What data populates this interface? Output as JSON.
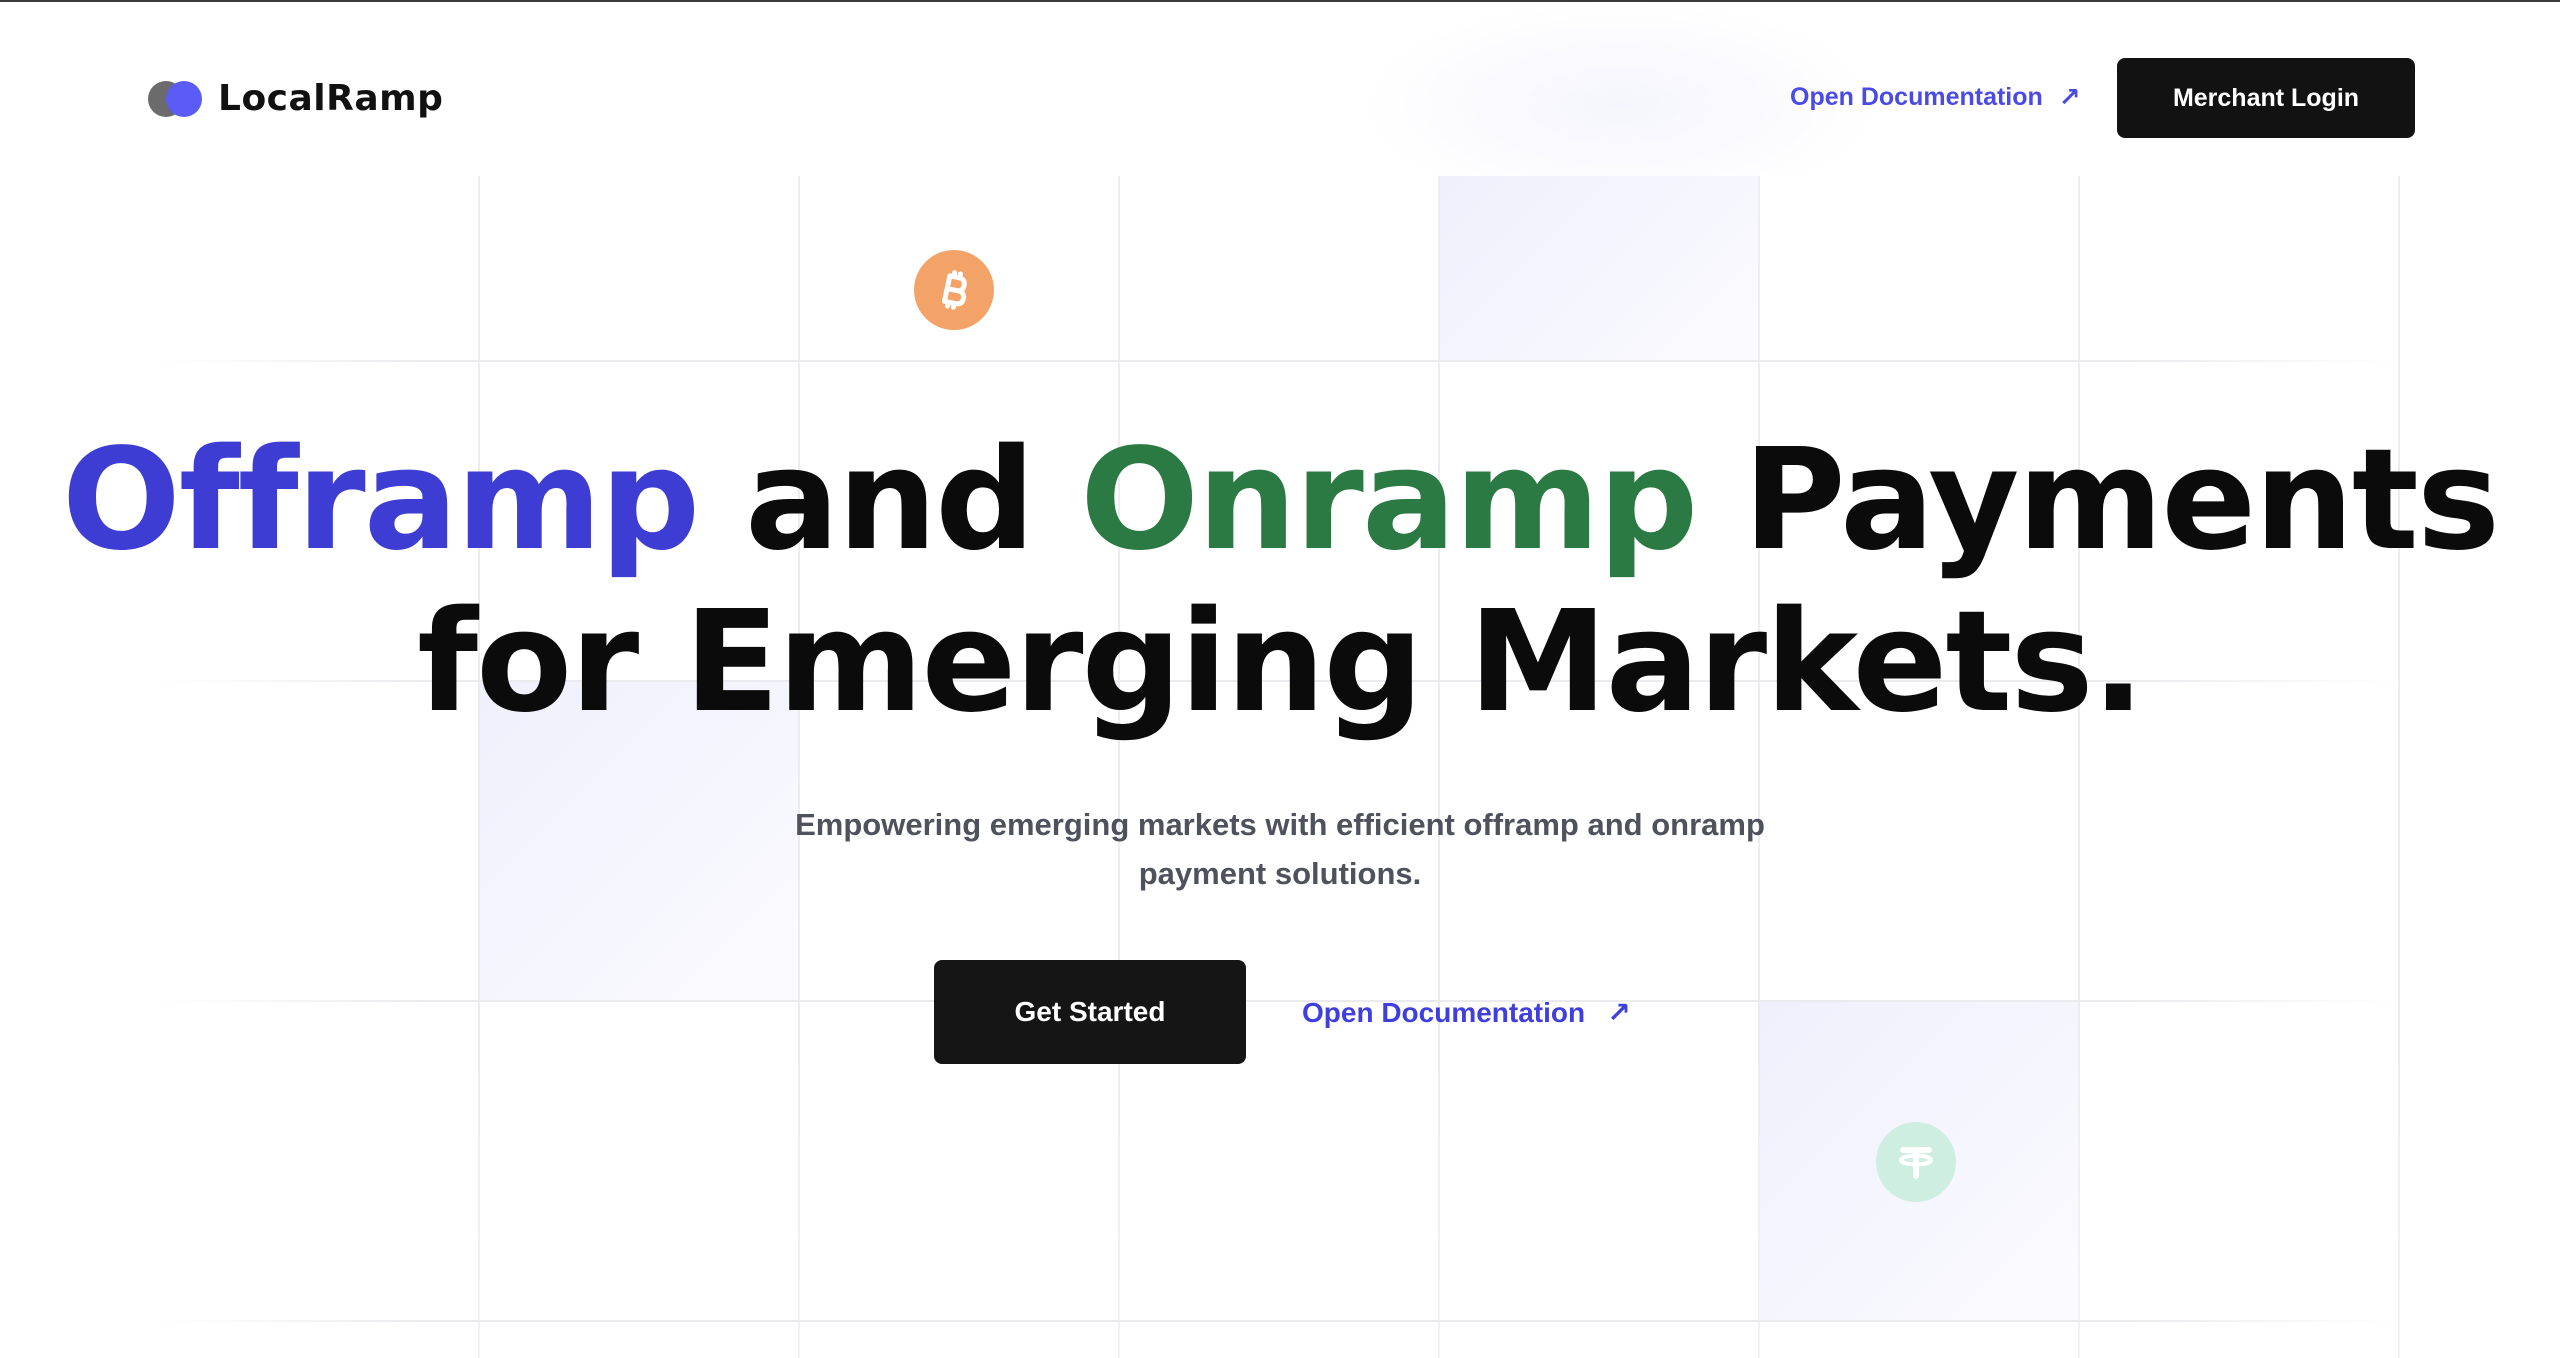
{
  "header": {
    "brand": "LocalRamp",
    "doc_link": "Open Documentation",
    "doc_arrow": "↗",
    "login_button": "Merchant Login"
  },
  "hero": {
    "headline_part1": "Offramp",
    "headline_part2": " and ",
    "headline_part3": "Onramp",
    "headline_part4": " Payments",
    "headline_line2": "for Emerging Markets.",
    "subtitle": "Empowering emerging markets with efficient offramp and onramp payment solutions.",
    "cta_button": "Get Started",
    "doc_link": "Open Documentation",
    "doc_arrow": "↗"
  },
  "icons": {
    "bitcoin": "bitcoin-icon",
    "tether": "tether-icon",
    "external_link": "arrow-up-right-icon"
  },
  "colors": {
    "brand_blue": "#3e3dd3",
    "brand_green": "#2b7a43",
    "link_blue": "#4a4ae6",
    "button_dark": "#121212",
    "bitcoin_orange": "#f3a367",
    "tether_mint": "#cfeee2"
  }
}
